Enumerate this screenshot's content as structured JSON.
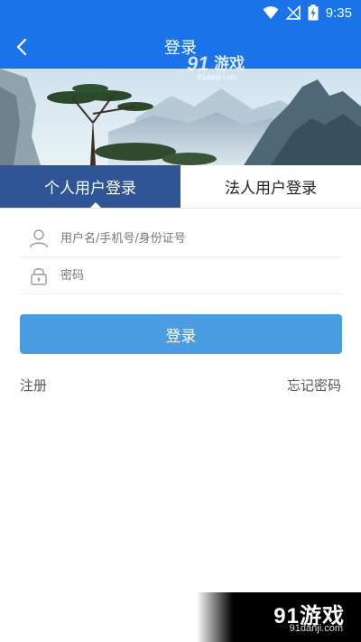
{
  "status_bar": {
    "time": "9:35",
    "icons": [
      "wifi-icon",
      "no-signal-icon",
      "battery-charging-icon"
    ]
  },
  "app_bar": {
    "title": "登录",
    "back_icon": "chevron-left-icon"
  },
  "watermark": {
    "brand": "91游戏",
    "url": "91danji.com"
  },
  "tabs": [
    {
      "label": "个人用户登录",
      "active": true
    },
    {
      "label": "法人用户登录",
      "active": false
    }
  ],
  "form": {
    "username": {
      "placeholder": "用户名/手机号/身份证号",
      "value": "",
      "icon": "user-icon"
    },
    "password": {
      "placeholder": "密码",
      "value": "",
      "icon": "lock-icon"
    }
  },
  "actions": {
    "login_label": "登录",
    "register_label": "注册",
    "forgot_label": "忘记密码"
  },
  "colors": {
    "primary": "#1a73e8",
    "tab_active": "#2f5597",
    "button": "#4a9de0"
  }
}
